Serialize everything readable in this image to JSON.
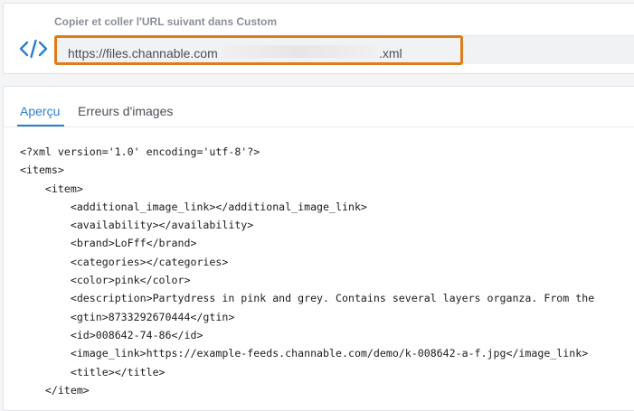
{
  "url_section": {
    "label": "Copier et coller l'URL suivant dans Custom",
    "icon": "code-icon",
    "url_visible_start": "https://files.channable.com",
    "url_visible_end": ".xml",
    "highlight_color": "#e07b1a"
  },
  "tabs": [
    {
      "label": "Aperçu",
      "active": true
    },
    {
      "label": "Erreurs d'images",
      "active": false
    }
  ],
  "accent_color": "#2a7fd4",
  "xml_lines": [
    "<?xml version='1.0' encoding='utf-8'?>",
    "<items>",
    "    <item>",
    "        <additional_image_link></additional_image_link>",
    "        <availability></availability>",
    "        <brand>LoFff</brand>",
    "        <categories></categories>",
    "        <color>pink</color>",
    "        <description>Partydress in pink and grey. Contains several layers organza. From the",
    "        <gtin>8733292670444</gtin>",
    "        <id>008642-74-86</id>",
    "        <image_link>https://example-feeds.channable.com/demo/k-008642-a-f.jpg</image_link>",
    "        <title></title>",
    "    </item>"
  ]
}
